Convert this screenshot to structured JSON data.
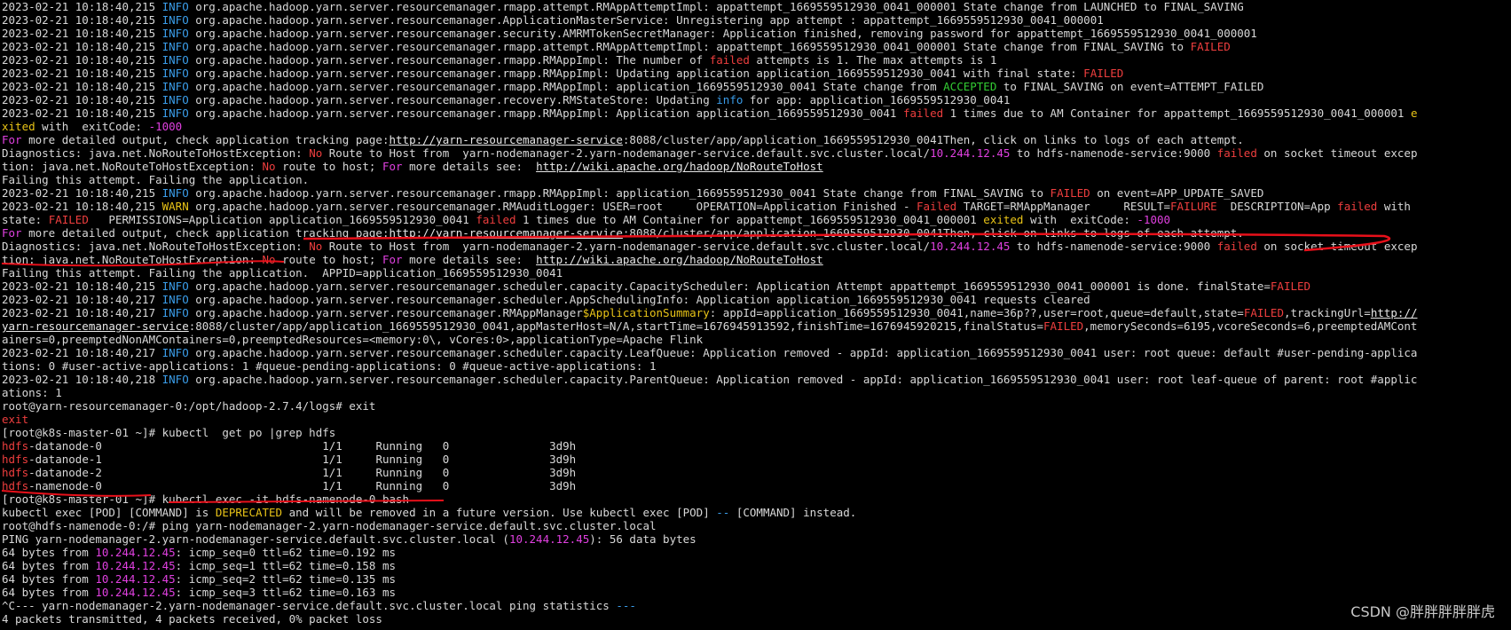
{
  "terminal": {
    "lines": [
      [
        [
          "t",
          "2023-02-21 10:18:40,215 "
        ],
        [
          "info",
          "INFO"
        ],
        [
          "t",
          " org.apache.hadoop.yarn.server.resourcemanager.rmapp.attempt.RMAppAttemptImpl: appattempt_1669559512930_0041_000001 State change from LAUNCHED to FINAL_SAVING"
        ]
      ],
      [
        [
          "t",
          "2023-02-21 10:18:40,215 "
        ],
        [
          "info",
          "INFO"
        ],
        [
          "t",
          " org.apache.hadoop.yarn.server.resourcemanager.ApplicationMasterService: Unregistering app attempt : appattempt_1669559512930_0041_000001"
        ]
      ],
      [
        [
          "t",
          "2023-02-21 10:18:40,215 "
        ],
        [
          "info",
          "INFO"
        ],
        [
          "t",
          " org.apache.hadoop.yarn.server.resourcemanager.security.AMRMTokenSecretManager: Application finished, removing password for appattempt_1669559512930_0041_000001"
        ]
      ],
      [
        [
          "t",
          "2023-02-21 10:18:40,215 "
        ],
        [
          "info",
          "INFO"
        ],
        [
          "t",
          " org.apache.hadoop.yarn.server.resourcemanager.rmapp.attempt.RMAppAttemptImpl: appattempt_1669559512930_0041_000001 State change from FINAL_SAVING to "
        ],
        [
          "red",
          "FAILED"
        ]
      ],
      [
        [
          "t",
          "2023-02-21 10:18:40,215 "
        ],
        [
          "info",
          "INFO"
        ],
        [
          "t",
          " org.apache.hadoop.yarn.server.resourcemanager.rmapp.RMAppImpl: The number of "
        ],
        [
          "red",
          "failed"
        ],
        [
          "t",
          " attempts is 1. The max attempts is 1"
        ]
      ],
      [
        [
          "t",
          "2023-02-21 10:18:40,215 "
        ],
        [
          "info",
          "INFO"
        ],
        [
          "t",
          " org.apache.hadoop.yarn.server.resourcemanager.rmapp.RMAppImpl: Updating application application_1669559512930_0041 with final state: "
        ],
        [
          "red",
          "FAILED"
        ]
      ],
      [
        [
          "t",
          "2023-02-21 10:18:40,215 "
        ],
        [
          "info",
          "INFO"
        ],
        [
          "t",
          " org.apache.hadoop.yarn.server.resourcemanager.rmapp.RMAppImpl: application_1669559512930_0041 State change from "
        ],
        [
          "green",
          "ACCEPTED"
        ],
        [
          "t",
          " to FINAL_SAVING on event=ATTEMPT_FAILED"
        ]
      ],
      [
        [
          "t",
          "2023-02-21 10:18:40,215 "
        ],
        [
          "info",
          "INFO"
        ],
        [
          "t",
          " org.apache.hadoop.yarn.server.resourcemanager.recovery.RMStateStore: Updating "
        ],
        [
          "info",
          "info"
        ],
        [
          "t",
          " for app: application_1669559512930_0041"
        ]
      ],
      [
        [
          "t",
          "2023-02-21 10:18:40,215 "
        ],
        [
          "info",
          "INFO"
        ],
        [
          "t",
          " org.apache.hadoop.yarn.server.resourcemanager.rmapp.RMAppImpl: Application application_1669559512930_0041 "
        ],
        [
          "red",
          "failed"
        ],
        [
          "t",
          " 1 times due to AM Container for appattempt_1669559512930_0041_000001 "
        ],
        [
          "warn",
          "e"
        ]
      ],
      [
        [
          "warn",
          "xited"
        ],
        [
          "t",
          " with  exitCode: "
        ],
        [
          "mag",
          "-1000"
        ]
      ],
      [
        [
          "mag",
          "For"
        ],
        [
          "t",
          " more detailed output, check application tracking page:"
        ],
        [
          "url",
          "http://yarn-resourcemanager-service"
        ],
        [
          "t",
          ":8088/cluster/app/application_1669559512930_0041Then, click on links to logs of each attempt."
        ]
      ],
      [
        [
          "t",
          "Diagnostics: java.net.NoRouteToHostException: "
        ],
        [
          "red",
          "No"
        ],
        [
          "t",
          " Route to Host from  yarn-nodemanager-2.yarn-nodemanager-service.default.svc.cluster.local/"
        ],
        [
          "mag",
          "10.244.12.45"
        ],
        [
          "t",
          " to hdfs-namenode-service:9000 "
        ],
        [
          "red",
          "failed"
        ],
        [
          "t",
          " on socket timeout excep"
        ]
      ],
      [
        [
          "t",
          "tion: java.net.NoRouteToHostException: "
        ],
        [
          "red",
          "No"
        ],
        [
          "t",
          " route to host; "
        ],
        [
          "mag",
          "For"
        ],
        [
          "t",
          " more details see:  "
        ],
        [
          "url",
          "http://wiki.apache.org/hadoop/NoRouteToHost"
        ]
      ],
      [
        [
          "t",
          "Failing this attempt. Failing the application."
        ]
      ],
      [
        [
          "t",
          "2023-02-21 10:18:40,215 "
        ],
        [
          "info",
          "INFO"
        ],
        [
          "t",
          " org.apache.hadoop.yarn.server.resourcemanager.rmapp.RMAppImpl: application_1669559512930_0041 State change from FINAL_SAVING to "
        ],
        [
          "red",
          "FAILED"
        ],
        [
          "t",
          " on event=APP_UPDATE_SAVED"
        ]
      ],
      [
        [
          "t",
          "2023-02-21 10:18:40,215 "
        ],
        [
          "warn",
          "WARN"
        ],
        [
          "t",
          " org.apache.hadoop.yarn.server.resourcemanager.RMAuditLogger: USER=root     OPERATION=Application Finished - "
        ],
        [
          "red",
          "Failed"
        ],
        [
          "t",
          " TARGET=RMAppManager     RESULT="
        ],
        [
          "red",
          "FAILURE"
        ],
        [
          "t",
          "  DESCRIPTION=App "
        ],
        [
          "red",
          "failed"
        ],
        [
          "t",
          " with"
        ]
      ],
      [
        [
          "t",
          "state: "
        ],
        [
          "red",
          "FAILED"
        ],
        [
          "t",
          "   PERMISSIONS=Application application_1669559512930_0041 "
        ],
        [
          "red",
          "failed"
        ],
        [
          "t",
          " 1 times due to AM Container for appattempt_1669559512930_0041_000001 "
        ],
        [
          "warn",
          "exited"
        ],
        [
          "t",
          " with  exitCode: "
        ],
        [
          "mag",
          "-1000"
        ]
      ],
      [
        [
          "mag",
          "For"
        ],
        [
          "t",
          " more detailed output, check application tracking page:"
        ],
        [
          "url",
          "http://yarn-resourcemanager-service"
        ],
        [
          "t",
          ":8088/cluster/app/application_1669559512930_0041Then, click on links to logs of each attempt."
        ]
      ],
      [
        [
          "t",
          "Diagnostics: java.net.NoRouteToHostException: "
        ],
        [
          "red",
          "No"
        ],
        [
          "t",
          " Route to Host from  yarn-nodemanager-2.yarn-nodemanager-service.default.svc.cluster.local/"
        ],
        [
          "mag",
          "10.244.12.45"
        ],
        [
          "t",
          " to hdfs-namenode-service:9000 "
        ],
        [
          "red",
          "failed"
        ],
        [
          "t",
          " on socket timeout excep"
        ]
      ],
      [
        [
          "t",
          "tion: java.net.NoRouteToHostException: "
        ],
        [
          "red",
          "No"
        ],
        [
          "t",
          " route to host; "
        ],
        [
          "mag",
          "For"
        ],
        [
          "t",
          " more details see:  "
        ],
        [
          "url",
          "http://wiki.apache.org/hadoop/NoRouteToHost"
        ]
      ],
      [
        [
          "t",
          "Failing this attempt. Failing the application.  APPID=application_1669559512930_0041"
        ]
      ],
      [
        [
          "t",
          "2023-02-21 10:18:40,215 "
        ],
        [
          "info",
          "INFO"
        ],
        [
          "t",
          " org.apache.hadoop.yarn.server.resourcemanager.scheduler.capacity.CapacityScheduler: Application Attempt appattempt_1669559512930_0041_000001 is done. finalState="
        ],
        [
          "red",
          "FAILED"
        ]
      ],
      [
        [
          "t",
          "2023-02-21 10:18:40,217 "
        ],
        [
          "info",
          "INFO"
        ],
        [
          "t",
          " org.apache.hadoop.yarn.server.resourcemanager.scheduler.AppSchedulingInfo: Application application_1669559512930_0041 requests cleared"
        ]
      ],
      [
        [
          "t",
          "2023-02-21 10:18:40,217 "
        ],
        [
          "info",
          "INFO"
        ],
        [
          "t",
          " org.apache.hadoop.yarn.server.resourcemanager.RMAppManager"
        ],
        [
          "warn",
          "$ApplicationSummary"
        ],
        [
          "t",
          ": appId=application_1669559512930_0041,name=36p??,user=root,queue=default,state="
        ],
        [
          "red",
          "FAILED"
        ],
        [
          "t",
          ",trackingUrl="
        ],
        [
          "url",
          "http://"
        ]
      ],
      [
        [
          "url",
          "yarn-resourcemanager-service"
        ],
        [
          "t",
          ":8088/cluster/app/application_1669559512930_0041,appMasterHost=N/A,startTime=1676945913592,finishTime=1676945920215,finalStatus="
        ],
        [
          "red",
          "FAILED"
        ],
        [
          "t",
          ",memorySeconds=6195,vcoreSeconds=6,preemptedAMCont"
        ]
      ],
      [
        [
          "t",
          "ainers=0,preemptedNonAMContainers=0,preemptedResources=<memory:0\\, vCores:0>,applicationType=Apache Flink"
        ]
      ],
      [
        [
          "t",
          "2023-02-21 10:18:40,217 "
        ],
        [
          "info",
          "INFO"
        ],
        [
          "t",
          " org.apache.hadoop.yarn.server.resourcemanager.scheduler.capacity.LeafQueue: Application removed - appId: application_1669559512930_0041 user: root queue: default #user-pending-applica"
        ]
      ],
      [
        [
          "t",
          "tions: 0 #user-active-applications: 1 #queue-pending-applications: 0 #queue-active-applications: 1"
        ]
      ],
      [
        [
          "t",
          "2023-02-21 10:18:40,218 "
        ],
        [
          "info",
          "INFO"
        ],
        [
          "t",
          " org.apache.hadoop.yarn.server.resourcemanager.scheduler.capacity.ParentQueue: Application removed - appId: application_1669559512930_0041 user: root leaf-queue of parent: root #applic"
        ]
      ],
      [
        [
          "t",
          "ations: 1"
        ]
      ],
      [
        [
          "t",
          "root@yarn-resourcemanager-0:/opt/hadoop-2.7.4/logs# exit"
        ]
      ],
      [
        [
          "red",
          "exit"
        ]
      ],
      [
        [
          "t",
          "[root@k8s-master-01 ~]# kubectl  get po |grep hdfs"
        ]
      ],
      [
        [
          "red",
          "hdfs"
        ],
        [
          "t",
          "-datanode-0                                 1/1     Running   0               3d9h"
        ]
      ],
      [
        [
          "red",
          "hdfs"
        ],
        [
          "t",
          "-datanode-1                                 1/1     Running   0               3d9h"
        ]
      ],
      [
        [
          "red",
          "hdfs"
        ],
        [
          "t",
          "-datanode-2                                 1/1     Running   0               3d9h"
        ]
      ],
      [
        [
          "red",
          "hdfs"
        ],
        [
          "t",
          "-namenode-0                                 1/1     Running   0               3d9h"
        ]
      ],
      [
        [
          "t",
          "[root@k8s-master-01 ~]# kubectl exec -it hdfs-namenode-0 bash"
        ]
      ],
      [
        [
          "t",
          "kubectl exec [POD] [COMMAND] is "
        ],
        [
          "warn",
          "DEPRECATED"
        ],
        [
          "t",
          " and will be removed in a future version. Use kubectl exec [POD] "
        ],
        [
          "info",
          "--"
        ],
        [
          "t",
          " [COMMAND] instead."
        ]
      ],
      [
        [
          "t",
          "root@hdfs-namenode-0:/# ping yarn-nodemanager-2.yarn-nodemanager-service.default.svc.cluster.local"
        ]
      ],
      [
        [
          "t",
          "PING yarn-nodemanager-2.yarn-nodemanager-service.default.svc.cluster.local ("
        ],
        [
          "mag",
          "10.244.12.45"
        ],
        [
          "t",
          "): 56 data bytes"
        ]
      ],
      [
        [
          "t",
          "64 bytes from "
        ],
        [
          "mag",
          "10.244.12.45"
        ],
        [
          "t",
          ": icmp_seq=0 ttl=62 time=0.192 ms"
        ]
      ],
      [
        [
          "t",
          "64 bytes from "
        ],
        [
          "mag",
          "10.244.12.45"
        ],
        [
          "t",
          ": icmp_seq=1 ttl=62 time=0.158 ms"
        ]
      ],
      [
        [
          "t",
          "64 bytes from "
        ],
        [
          "mag",
          "10.244.12.45"
        ],
        [
          "t",
          ": icmp_seq=2 ttl=62 time=0.135 ms"
        ]
      ],
      [
        [
          "t",
          "64 bytes from "
        ],
        [
          "mag",
          "10.244.12.45"
        ],
        [
          "t",
          ": icmp_seq=3 ttl=62 time=0.163 ms"
        ]
      ],
      [
        [
          "t",
          "^C--- yarn-nodemanager-2.yarn-nodemanager-service.default.svc.cluster.local ping statistics "
        ],
        [
          "info",
          "---"
        ]
      ],
      [
        [
          "t",
          "4 packets transmitted, 4 packets received, 0% packet loss"
        ]
      ]
    ]
  },
  "watermark": "CSDN @胖胖胖胖胖虎",
  "colors": {
    "background": "#000000",
    "text": "#d8d8d8",
    "info": "#3a9ce8",
    "error": "#ee3e3e",
    "warn": "#e8c317",
    "success": "#33cc33",
    "highlight": "#e040e0",
    "annotation": "#e8101a"
  }
}
